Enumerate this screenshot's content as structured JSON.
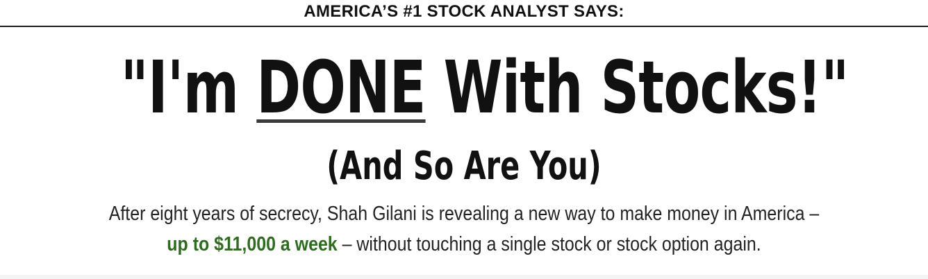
{
  "kicker": "AMERICA’S #1 STOCK ANALYST SAYS:",
  "headline": {
    "open_quote_part": "\"I'm ",
    "emphasis": "DONE",
    "rest": " With Stocks!\""
  },
  "subheadline": "(And So Are You)",
  "body": {
    "line1": "After eight years of secrecy, Shah Gilani is revealing a new way to make money in America –",
    "highlight": "up to $11,000 a week",
    "line2_rest": " – without touching a single stock or stock option again."
  },
  "colors": {
    "text": "#111111",
    "highlight_green": "#2e6b1f"
  }
}
